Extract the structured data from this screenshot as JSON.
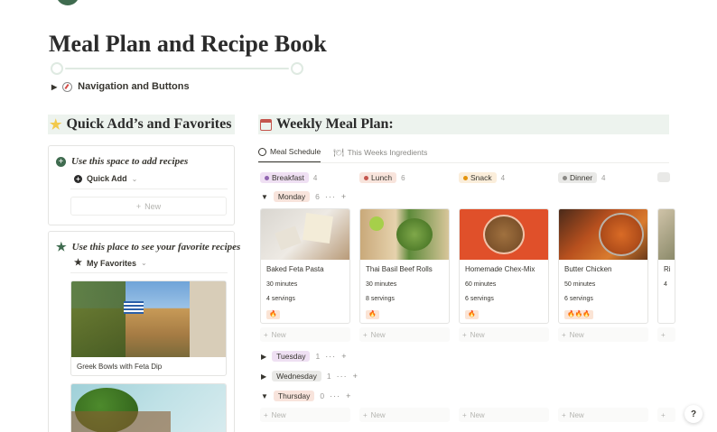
{
  "page": {
    "title": "Meal Plan and Recipe Book",
    "toggle_label": "Navigation and Buttons"
  },
  "left": {
    "heading": "Quick Add’s and Favorites",
    "callout1": {
      "title": "Use this space to add recipes",
      "item": "Quick Add",
      "new_label": "New"
    },
    "callout2": {
      "title": "Use this place to see your favorite recipes",
      "item": "My Favorites",
      "cards": [
        {
          "name": "Greek Bowls with Feta Dip"
        },
        {
          "name": ""
        }
      ]
    }
  },
  "right": {
    "heading": "Weekly Meal Plan:",
    "tabs": [
      {
        "label": "Meal Schedule",
        "icon": "clock-icon",
        "active": true
      },
      {
        "label": "This Weeks Ingredients",
        "icon": "utensils-icon",
        "active": false
      }
    ],
    "columns": [
      {
        "label": "Breakfast",
        "count": "4",
        "bg": "#efe0f3",
        "dot": "#9065b0"
      },
      {
        "label": "Lunch",
        "count": "6",
        "bg": "#f8e4dc",
        "dot": "#c4554d"
      },
      {
        "label": "Snack",
        "count": "4",
        "bg": "#fbeedb",
        "dot": "#e3930d"
      },
      {
        "label": "Dinner",
        "count": "4",
        "bg": "#e9e9e7",
        "dot": "#8a8985"
      }
    ],
    "groups": [
      {
        "label": "Monday",
        "count": "6",
        "bg": "#f8e4dc"
      },
      {
        "label": "Tuesday",
        "count": "1",
        "bg": "#efe0f3"
      },
      {
        "label": "Wednesday",
        "count": "1",
        "bg": "#e9e9e7"
      },
      {
        "label": "Thursday",
        "count": "0",
        "bg": "#f8e4dc"
      }
    ],
    "meals": [
      {
        "name": "Baked Feta Pasta",
        "time": "30 minutes",
        "servings": "4 servings",
        "spice": "🔥"
      },
      {
        "name": "Thai Basil Beef Rolls",
        "time": "30 minutes",
        "servings": "8 servings",
        "spice": "🔥"
      },
      {
        "name": "Homemade Chex-Mix",
        "time": "60 minutes",
        "servings": "6 servings",
        "spice": "🔥"
      },
      {
        "name": "Butter Chicken",
        "time": "50 minutes",
        "servings": "6 servings",
        "spice": "🔥🔥🔥"
      },
      {
        "name": "Ri",
        "time": "4",
        "servings": "",
        "spice": ""
      }
    ],
    "new_label": "New",
    "controls": "···",
    "add": "+"
  },
  "help": "?",
  "colors": {
    "accent_green": "#3f6b4f",
    "section_bg": "#edf3ee"
  }
}
